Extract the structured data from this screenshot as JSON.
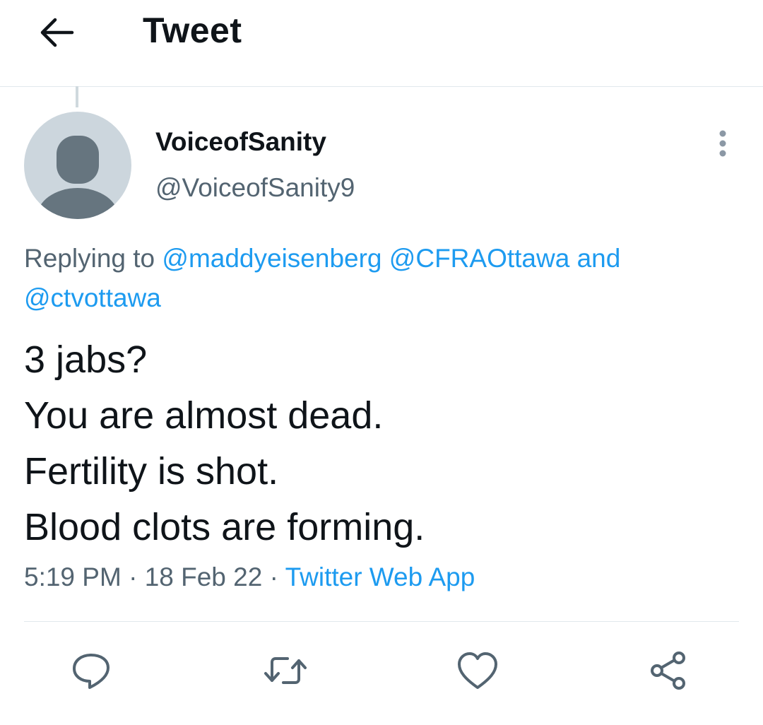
{
  "header": {
    "title": "Tweet",
    "back_icon": "arrow-left-icon"
  },
  "tweet": {
    "display_name": "VoiceofSanity",
    "handle": "@VoiceofSanity9",
    "avatar_icon": "default-avatar-icon",
    "more_icon": "more-vertical-icon",
    "replying": {
      "prefix": "Replying to",
      "mentions": [
        "@maddyeisenberg",
        "@CFRAOttawa",
        "@ctvottawa"
      ],
      "conjunction": "and"
    },
    "text_lines": [
      "3 jabs?",
      "You are almost dead.",
      "Fertility is shot.",
      "Blood clots are forming."
    ],
    "time": "5:19 PM",
    "separator": "·",
    "date": "18 Feb 22",
    "source": "Twitter Web App"
  },
  "actions": [
    {
      "name": "reply-button",
      "icon": "reply-icon"
    },
    {
      "name": "retweet-button",
      "icon": "retweet-icon"
    },
    {
      "name": "like-button",
      "icon": "heart-icon"
    },
    {
      "name": "share-button",
      "icon": "share-icon"
    }
  ],
  "colors": {
    "link": "#1d9bf0",
    "secondary_text": "#536471",
    "icon": "#536471",
    "divider": "#e1e8ed",
    "avatar_bg": "#ccd6dd",
    "avatar_fg": "#66757f"
  }
}
